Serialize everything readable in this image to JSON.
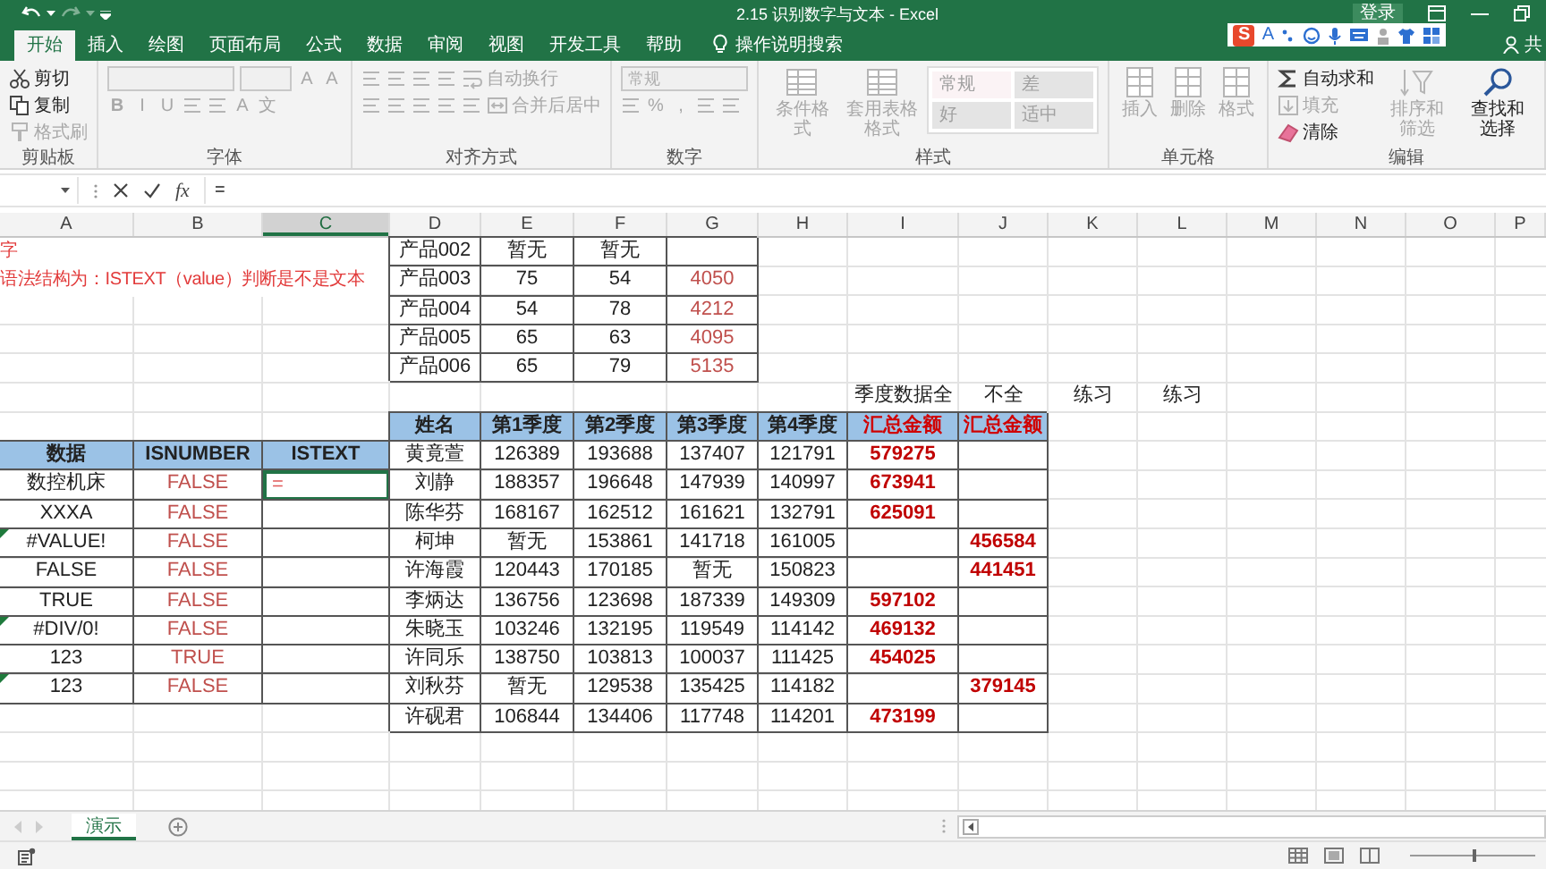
{
  "window": {
    "title": "2.15 识别数字与文本 - Excel",
    "sign_in": "登录",
    "share": "共"
  },
  "ime_toolbar": {
    "logo": "S",
    "mode": "A"
  },
  "tabs": [
    {
      "label": "开始",
      "selected": true
    },
    {
      "label": "插入",
      "selected": false
    },
    {
      "label": "绘图",
      "selected": false
    },
    {
      "label": "页面布局",
      "selected": false
    },
    {
      "label": "公式",
      "selected": false
    },
    {
      "label": "数据",
      "selected": false
    },
    {
      "label": "审阅",
      "selected": false
    },
    {
      "label": "视图",
      "selected": false
    },
    {
      "label": "开发工具",
      "selected": false
    },
    {
      "label": "帮助",
      "selected": false
    }
  ],
  "tell_me": "操作说明搜索",
  "ribbon": [
    {
      "label": "剪贴板",
      "blocks": [
        {
          "kind": "rows",
          "rows": [
            [
              {
                "kind": "small",
                "text": "剪切",
                "disabled": false
              }
            ],
            [
              {
                "kind": "small",
                "text": "复制",
                "disabled": false
              }
            ],
            [
              {
                "kind": "small",
                "text": "格式刷",
                "disabled": true
              }
            ]
          ]
        }
      ]
    },
    {
      "label": "字体",
      "blocks": [
        {
          "kind": "rows",
          "rows": [
            [
              {
                "kind": "field",
                "disabled": true
              },
              {
                "kind": "field",
                "disabled": true
              },
              {
                "kind": "glyph",
                "text": "A",
                "disabled": true
              },
              {
                "kind": "glyph",
                "text": "A",
                "disabled": true
              }
            ],
            [
              {
                "kind": "glyph",
                "text": "B",
                "disabled": true
              },
              {
                "kind": "glyph",
                "text": "I",
                "disabled": true
              },
              {
                "kind": "glyph",
                "text": "U",
                "disabled": true
              },
              {
                "kind": "tool",
                "disabled": true
              },
              {
                "kind": "tool",
                "disabled": true
              },
              {
                "kind": "glyph",
                "text": "A",
                "disabled": true
              },
              {
                "kind": "glyph",
                "text": "文",
                "disabled": true
              }
            ]
          ]
        }
      ]
    },
    {
      "label": "对齐方式",
      "blocks": [
        {
          "kind": "rows",
          "rows": [
            [
              {
                "kind": "tool",
                "disabled": true
              },
              {
                "kind": "tool",
                "disabled": true
              },
              {
                "kind": "tool",
                "disabled": true
              },
              {
                "kind": "tool",
                "disabled": true
              },
              {
                "kind": "small",
                "text": "自动换行",
                "disabled": true
              }
            ],
            [
              {
                "kind": "tool",
                "disabled": true
              },
              {
                "kind": "tool",
                "disabled": true
              },
              {
                "kind": "tool",
                "disabled": true
              },
              {
                "kind": "tool",
                "disabled": true
              },
              {
                "kind": "tool",
                "disabled": true
              },
              {
                "kind": "small",
                "text": "合并后居中",
                "disabled": true
              }
            ]
          ]
        }
      ]
    },
    {
      "label": "数字",
      "blocks": [
        {
          "kind": "rows",
          "rows": [
            [
              {
                "kind": "field",
                "text": "常规",
                "disabled": true
              }
            ],
            [
              {
                "kind": "tool",
                "disabled": true
              },
              {
                "kind": "glyph",
                "text": "%",
                "disabled": true
              },
              {
                "kind": "glyph",
                "text": ",",
                "disabled": true
              },
              {
                "kind": "tool",
                "disabled": true
              },
              {
                "kind": "tool",
                "disabled": true
              }
            ]
          ]
        }
      ]
    },
    {
      "label": "样式",
      "blocks": [
        {
          "kind": "large",
          "text": "条件格式",
          "disabled": true
        },
        {
          "kind": "large",
          "text": "套用表格格式",
          "disabled": true
        },
        {
          "kind": "gallery",
          "styles": [
            {
              "text": "常规",
              "disabled": true
            },
            {
              "text": "差",
              "disabled": true
            },
            {
              "text": "好",
              "disabled": true
            },
            {
              "text": "适中",
              "disabled": true
            }
          ]
        }
      ]
    },
    {
      "label": "单元格",
      "blocks": [
        {
          "kind": "large",
          "text": "插入",
          "disabled": true
        },
        {
          "kind": "large",
          "text": "删除",
          "disabled": true
        },
        {
          "kind": "large",
          "text": "格式",
          "disabled": true
        }
      ]
    },
    {
      "label": "编辑",
      "blocks": [
        {
          "kind": "rows",
          "rows": [
            [
              {
                "kind": "small",
                "text": "自动求和",
                "disabled": false
              }
            ],
            [
              {
                "kind": "small",
                "text": "填充",
                "disabled": true
              }
            ],
            [
              {
                "kind": "small",
                "text": "清除",
                "disabled": false
              }
            ]
          ]
        },
        {
          "kind": "large",
          "text": "排序和筛选",
          "disabled": true
        },
        {
          "kind": "large",
          "text": "查找和选择",
          "disabled": false
        }
      ]
    }
  ],
  "formula_bar": {
    "function_label": "fx",
    "formula": "="
  },
  "sheet": {
    "columns": [
      {
        "label": "A",
        "selected": false
      },
      {
        "label": "B",
        "selected": false
      },
      {
        "label": "C",
        "selected": true
      },
      {
        "label": "D",
        "selected": false
      },
      {
        "label": "E",
        "selected": false
      },
      {
        "label": "F",
        "selected": false
      },
      {
        "label": "G",
        "selected": false
      },
      {
        "label": "H",
        "selected": false
      },
      {
        "label": "I",
        "selected": false
      },
      {
        "label": "J",
        "selected": false
      },
      {
        "label": "K",
        "selected": false
      },
      {
        "label": "L",
        "selected": false
      },
      {
        "label": "M",
        "selected": false
      },
      {
        "label": "N",
        "selected": false
      },
      {
        "label": "O",
        "selected": false
      },
      {
        "label": "P",
        "selected": false
      }
    ],
    "rows": [
      {
        "cells": [
          {
            "kind": "note",
            "text": "字"
          },
          {
            "kind": "covered"
          },
          {
            "kind": "covered"
          },
          {
            "kind": "cell",
            "text": "产品002"
          },
          {
            "kind": "cell",
            "text": "暂无"
          },
          {
            "kind": "cell",
            "text": "暂无"
          },
          {
            "kind": "cell"
          }
        ]
      },
      {
        "cells": [
          {
            "kind": "note",
            "text": "语法结构为：ISTEXT（value）判断是不是文本"
          },
          {
            "kind": "covered"
          },
          {
            "kind": "covered"
          },
          {
            "kind": "cell",
            "text": "产品003"
          },
          {
            "kind": "cell",
            "text": "75"
          },
          {
            "kind": "cell",
            "text": "54"
          },
          {
            "kind": "cell-red",
            "text": "4050"
          }
        ]
      },
      {
        "cells": [
          {
            "kind": "blank"
          },
          {
            "kind": "blank"
          },
          {
            "kind": "blank"
          },
          {
            "kind": "cell",
            "text": "产品004"
          },
          {
            "kind": "cell",
            "text": "54"
          },
          {
            "kind": "cell",
            "text": "78"
          },
          {
            "kind": "cell-red",
            "text": "4212"
          }
        ]
      },
      {
        "cells": [
          {
            "kind": "blank"
          },
          {
            "kind": "blank"
          },
          {
            "kind": "blank"
          },
          {
            "kind": "cell",
            "text": "产品005"
          },
          {
            "kind": "cell",
            "text": "65"
          },
          {
            "kind": "cell",
            "text": "63"
          },
          {
            "kind": "cell-red",
            "text": "4095"
          }
        ]
      },
      {
        "cells": [
          {
            "kind": "blank"
          },
          {
            "kind": "blank"
          },
          {
            "kind": "blank"
          },
          {
            "kind": "cell",
            "text": "产品006"
          },
          {
            "kind": "cell",
            "text": "65"
          },
          {
            "kind": "cell",
            "text": "79"
          },
          {
            "kind": "cell-red",
            "text": "5135"
          }
        ]
      },
      {
        "cells": [
          {
            "kind": "blank"
          },
          {
            "kind": "blank"
          },
          {
            "kind": "blank"
          },
          {
            "kind": "blank"
          },
          {
            "kind": "blank"
          },
          {
            "kind": "blank"
          },
          {
            "kind": "blank"
          },
          {
            "kind": "blank"
          },
          {
            "kind": "label",
            "text": "季度数据全"
          },
          {
            "kind": "label",
            "text": "不全"
          },
          {
            "kind": "label",
            "text": "练习"
          },
          {
            "kind": "label",
            "text": "练习"
          }
        ]
      },
      {
        "cells": [
          {
            "kind": "blank"
          },
          {
            "kind": "blank"
          },
          {
            "kind": "blank"
          },
          {
            "kind": "header",
            "text": "姓名"
          },
          {
            "kind": "header",
            "text": "第1季度"
          },
          {
            "kind": "header",
            "text": "第2季度"
          },
          {
            "kind": "header",
            "text": "第3季度"
          },
          {
            "kind": "header",
            "text": "第4季度"
          },
          {
            "kind": "header-red",
            "text": "汇总金额"
          },
          {
            "kind": "header-red",
            "text": "汇总金额"
          }
        ]
      },
      {
        "cells": [
          {
            "kind": "header",
            "text": "数据"
          },
          {
            "kind": "header",
            "text": "ISNUMBER"
          },
          {
            "kind": "header",
            "text": "ISTEXT"
          },
          {
            "kind": "cell",
            "text": "黄竟萱"
          },
          {
            "kind": "cell",
            "text": "126389"
          },
          {
            "kind": "cell",
            "text": "193688"
          },
          {
            "kind": "cell",
            "text": "137407"
          },
          {
            "kind": "cell",
            "text": "121791"
          },
          {
            "kind": "total",
            "text": "579275"
          },
          {
            "kind": "cell"
          }
        ]
      },
      {
        "cells": [
          {
            "kind": "cell",
            "text": "数控机床"
          },
          {
            "kind": "cell-red",
            "text": "FALSE"
          },
          {
            "kind": "active",
            "text": "="
          },
          {
            "kind": "cell",
            "text": "刘静"
          },
          {
            "kind": "cell",
            "text": "188357"
          },
          {
            "kind": "cell",
            "text": "196648"
          },
          {
            "kind": "cell",
            "text": "147939"
          },
          {
            "kind": "cell",
            "text": "140997"
          },
          {
            "kind": "total",
            "text": "673941"
          },
          {
            "kind": "cell"
          }
        ]
      },
      {
        "cells": [
          {
            "kind": "cell",
            "text": "XXXA"
          },
          {
            "kind": "cell-red",
            "text": "FALSE"
          },
          {
            "kind": "cell"
          },
          {
            "kind": "cell",
            "text": "陈华芬"
          },
          {
            "kind": "cell",
            "text": "168167"
          },
          {
            "kind": "cell",
            "text": "162512"
          },
          {
            "kind": "cell",
            "text": "161621"
          },
          {
            "kind": "cell",
            "text": "132791"
          },
          {
            "kind": "total",
            "text": "625091"
          },
          {
            "kind": "cell"
          }
        ]
      },
      {
        "cells": [
          {
            "kind": "flag",
            "text": "#VALUE!"
          },
          {
            "kind": "cell-red",
            "text": "FALSE"
          },
          {
            "kind": "cell"
          },
          {
            "kind": "cell",
            "text": "柯坤"
          },
          {
            "kind": "cell",
            "text": "暂无"
          },
          {
            "kind": "cell",
            "text": "153861"
          },
          {
            "kind": "cell",
            "text": "141718"
          },
          {
            "kind": "cell",
            "text": "161005"
          },
          {
            "kind": "cell"
          },
          {
            "kind": "total",
            "text": "456584"
          }
        ]
      },
      {
        "cells": [
          {
            "kind": "cell",
            "text": "FALSE"
          },
          {
            "kind": "cell-red",
            "text": "FALSE"
          },
          {
            "kind": "cell"
          },
          {
            "kind": "cell",
            "text": "许海霞"
          },
          {
            "kind": "cell",
            "text": "120443"
          },
          {
            "kind": "cell",
            "text": "170185"
          },
          {
            "kind": "cell",
            "text": "暂无"
          },
          {
            "kind": "cell",
            "text": "150823"
          },
          {
            "kind": "cell"
          },
          {
            "kind": "total",
            "text": "441451"
          }
        ]
      },
      {
        "cells": [
          {
            "kind": "cell",
            "text": "TRUE"
          },
          {
            "kind": "cell-red",
            "text": "FALSE"
          },
          {
            "kind": "cell"
          },
          {
            "kind": "cell",
            "text": "李炳达"
          },
          {
            "kind": "cell",
            "text": "136756"
          },
          {
            "kind": "cell",
            "text": "123698"
          },
          {
            "kind": "cell",
            "text": "187339"
          },
          {
            "kind": "cell",
            "text": "149309"
          },
          {
            "kind": "total",
            "text": "597102"
          },
          {
            "kind": "cell"
          }
        ]
      },
      {
        "cells": [
          {
            "kind": "flag",
            "text": "#DIV/0!"
          },
          {
            "kind": "cell-red",
            "text": "FALSE"
          },
          {
            "kind": "cell"
          },
          {
            "kind": "cell",
            "text": "朱晓玉"
          },
          {
            "kind": "cell",
            "text": "103246"
          },
          {
            "kind": "cell",
            "text": "132195"
          },
          {
            "kind": "cell",
            "text": "119549"
          },
          {
            "kind": "cell",
            "text": "114142"
          },
          {
            "kind": "total",
            "text": "469132"
          },
          {
            "kind": "cell"
          }
        ]
      },
      {
        "cells": [
          {
            "kind": "cell",
            "text": "123"
          },
          {
            "kind": "cell-red",
            "text": "TRUE"
          },
          {
            "kind": "cell"
          },
          {
            "kind": "cell",
            "text": "许同乐"
          },
          {
            "kind": "cell",
            "text": "138750"
          },
          {
            "kind": "cell",
            "text": "103813"
          },
          {
            "kind": "cell",
            "text": "100037"
          },
          {
            "kind": "cell",
            "text": "111425"
          },
          {
            "kind": "total",
            "text": "454025"
          },
          {
            "kind": "cell"
          }
        ]
      },
      {
        "cells": [
          {
            "kind": "flag",
            "text": "123"
          },
          {
            "kind": "cell-red",
            "text": "FALSE"
          },
          {
            "kind": "cell"
          },
          {
            "kind": "cell",
            "text": "刘秋芬"
          },
          {
            "kind": "cell",
            "text": "暂无"
          },
          {
            "kind": "cell",
            "text": "129538"
          },
          {
            "kind": "cell",
            "text": "135425"
          },
          {
            "kind": "cell",
            "text": "114182"
          },
          {
            "kind": "cell"
          },
          {
            "kind": "total",
            "text": "379145"
          }
        ]
      },
      {
        "cells": [
          {
            "kind": "blank"
          },
          {
            "kind": "blank"
          },
          {
            "kind": "blank"
          },
          {
            "kind": "cell",
            "text": "许砚君"
          },
          {
            "kind": "cell",
            "text": "106844"
          },
          {
            "kind": "cell",
            "text": "134406"
          },
          {
            "kind": "cell",
            "text": "117748"
          },
          {
            "kind": "cell",
            "text": "114201"
          },
          {
            "kind": "total",
            "text": "473199"
          },
          {
            "kind": "cell"
          }
        ]
      }
    ]
  },
  "sheet_tabs": [
    {
      "label": "演示",
      "selected": true
    }
  ],
  "status_bar": {
    "zoom": {
      "level": 0.5
    }
  }
}
